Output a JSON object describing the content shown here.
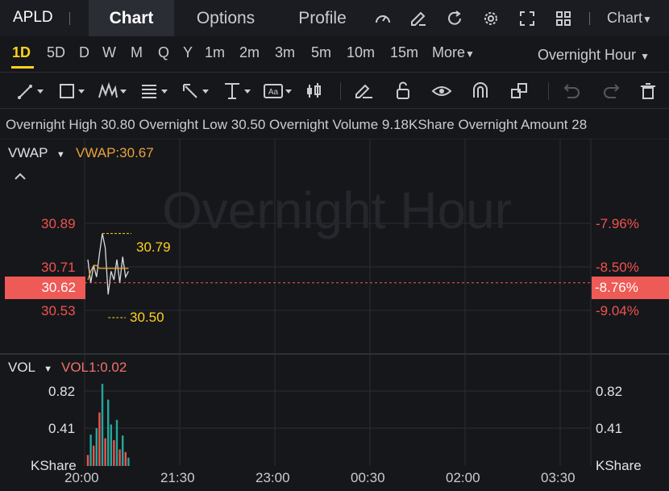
{
  "header": {
    "symbol": "APLD",
    "tabs": [
      "Chart",
      "Options",
      "Profile"
    ],
    "chart_type_label": "Chart"
  },
  "periods": {
    "items": [
      "1D",
      "5D",
      "D",
      "W",
      "M",
      "Q",
      "Y",
      "1m",
      "2m",
      "3m",
      "5m",
      "10m",
      "15m",
      "More"
    ],
    "active": "1D",
    "session": "Overnight Hour"
  },
  "info": {
    "high_label": "Overnight High",
    "high": "30.80",
    "low_label": "Overnight Low",
    "low": "30.50",
    "volume_label": "Overnight Volume",
    "volume": "9.18KShare",
    "amount_label": "Overnight Amount",
    "amount": "28"
  },
  "price_panel": {
    "indicator": "VWAP",
    "indicator_value": "VWAP:30.67",
    "watermark": "Overnight Hour",
    "left_ticks": [
      "30.89",
      "30.71",
      "30.53"
    ],
    "current_price": "30.62",
    "right_ticks": [
      "-7.96%",
      "-8.50%",
      "-9.04%"
    ],
    "current_pct": "-8.76%",
    "high_marker": "30.79",
    "low_marker": "30.50"
  },
  "volume_panel": {
    "indicator": "VOL",
    "indicator_value": "VOL1:0.02",
    "ticks": [
      "0.82",
      "0.41"
    ],
    "unit": "KShare"
  },
  "time_axis": [
    "20:00",
    "21:30",
    "23:00",
    "00:30",
    "02:00",
    "03:30"
  ],
  "colors": {
    "accent": "#ffd21e",
    "down": "#f0524e",
    "up": "#26a69a",
    "vwap": "#e9a23b"
  },
  "chart_data": {
    "type": "line",
    "x": [
      "20:00",
      "20:03",
      "20:06",
      "20:09",
      "20:12",
      "20:15",
      "20:18",
      "20:21",
      "20:24",
      "20:27",
      "20:30",
      "20:33",
      "20:36",
      "20:39",
      "20:42"
    ],
    "series": [
      {
        "name": "VWAP",
        "values": [
          30.63,
          30.66,
          30.68,
          30.68,
          30.67,
          30.67,
          30.67,
          30.67,
          30.67,
          30.67,
          30.67,
          30.67,
          30.67,
          30.67,
          30.67
        ]
      }
    ],
    "price": [
      30.7,
      30.62,
      30.68,
      30.64,
      30.72,
      30.79,
      30.74,
      30.58,
      30.66,
      30.63,
      30.7,
      30.62,
      30.71,
      30.64,
      30.66
    ],
    "volume": [
      0.12,
      0.34,
      0.22,
      0.41,
      0.58,
      0.89,
      0.3,
      0.72,
      0.45,
      0.28,
      0.5,
      0.18,
      0.33,
      0.15,
      0.09
    ],
    "volume_direction": [
      "down",
      "up",
      "down",
      "up",
      "down",
      "up",
      "down",
      "up",
      "up",
      "down",
      "up",
      "down",
      "up",
      "down",
      "up"
    ],
    "ylim": [
      30.45,
      30.95
    ],
    "vol_ylim": [
      0,
      0.9
    ]
  }
}
